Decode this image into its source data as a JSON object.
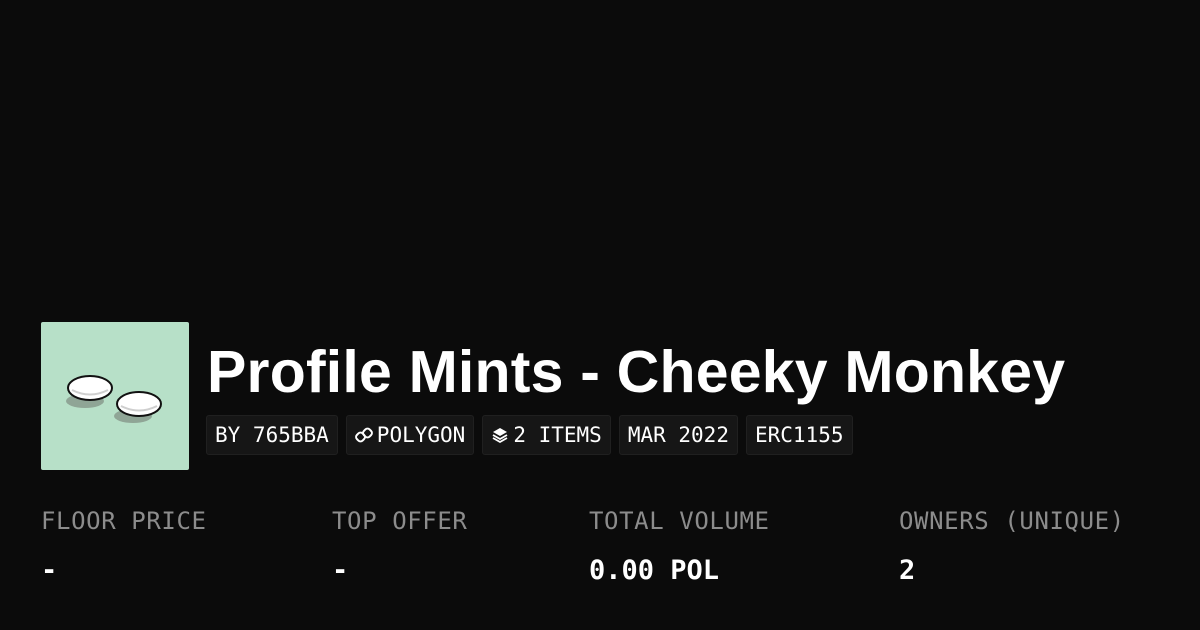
{
  "collection": {
    "title": "Profile Mints - Cheeky Monkey",
    "badges": {
      "creator": "BY 765BBA",
      "chain": "POLYGON",
      "items": "2 ITEMS",
      "date": "MAR 2022",
      "standard": "ERC1155"
    },
    "thumbnail_bg": "#b7e0c8"
  },
  "stats": [
    {
      "label": "FLOOR PRICE",
      "value": "-"
    },
    {
      "label": "TOP OFFER",
      "value": "-"
    },
    {
      "label": "TOTAL VOLUME",
      "value": "0.00 POL"
    },
    {
      "label": "OWNERS (UNIQUE)",
      "value": "2"
    }
  ],
  "colors": {
    "background": "#0b0b0b",
    "text": "#ffffff",
    "muted": "#8c8c8c",
    "badge_bg": "#161616"
  },
  "icons": {
    "chain": "link-icon",
    "items": "layers-icon"
  }
}
